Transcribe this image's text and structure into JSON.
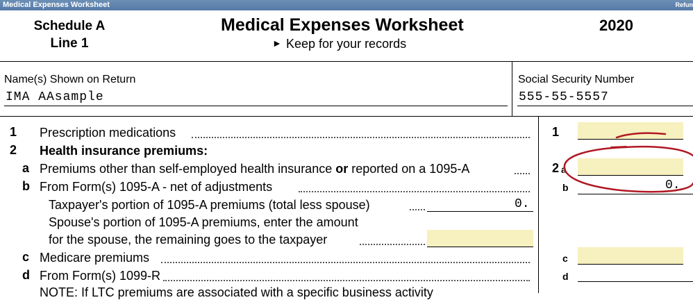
{
  "window": {
    "title": "Medical Expenses Worksheet",
    "right_label": "Refun"
  },
  "header": {
    "schedule_line1": "Schedule A",
    "schedule_line2": "Line 1",
    "title": "Medical Expenses Worksheet",
    "subtitle_arrow": "►",
    "subtitle": "Keep for your records",
    "year": "2020"
  },
  "fields": {
    "name_label": "Name(s) Shown on Return",
    "name_value": "IMA AAsample",
    "ssn_label": "Social Security Number",
    "ssn_value": "555-55-5557"
  },
  "lines": {
    "l1_num": "1",
    "l1_text": "Prescription medications",
    "l1_ref": "1",
    "l2_num": "2",
    "l2_text": "Health insurance premiums:",
    "l2a_letter": "a",
    "l2a_text_pre": "Premiums other than self-employed health insurance ",
    "l2a_text_or": "or",
    "l2a_text_post": " reported on a 1095-A",
    "l2a_ref_num": "2",
    "l2a_ref_letter": "a",
    "l2b_letter": "b",
    "l2b_text": "From Form(s) 1095-A - net of adjustments",
    "l2b_ref": "b",
    "l2b_value": "0.",
    "tp_text": "Taxpayer's portion of 1095-A premiums (total less spouse)",
    "tp_value": "0.",
    "sp_text1": "Spouse's portion of 1095-A premiums, enter the amount",
    "sp_text2": "for the spouse, the remaining goes to the taxpayer",
    "l2c_letter": "c",
    "l2c_text": "Medicare premiums",
    "l2c_ref": "c",
    "l2d_letter": "d",
    "l2d_text": "From Form(s) 1099-R",
    "l2d_ref": "d",
    "note_text": "NOTE:  If LTC premiums are associated with a specific business activity"
  },
  "colors": {
    "input_bg": "#f7f0bf",
    "annotation": "#b01822",
    "titlebar": "#5f84b0"
  }
}
